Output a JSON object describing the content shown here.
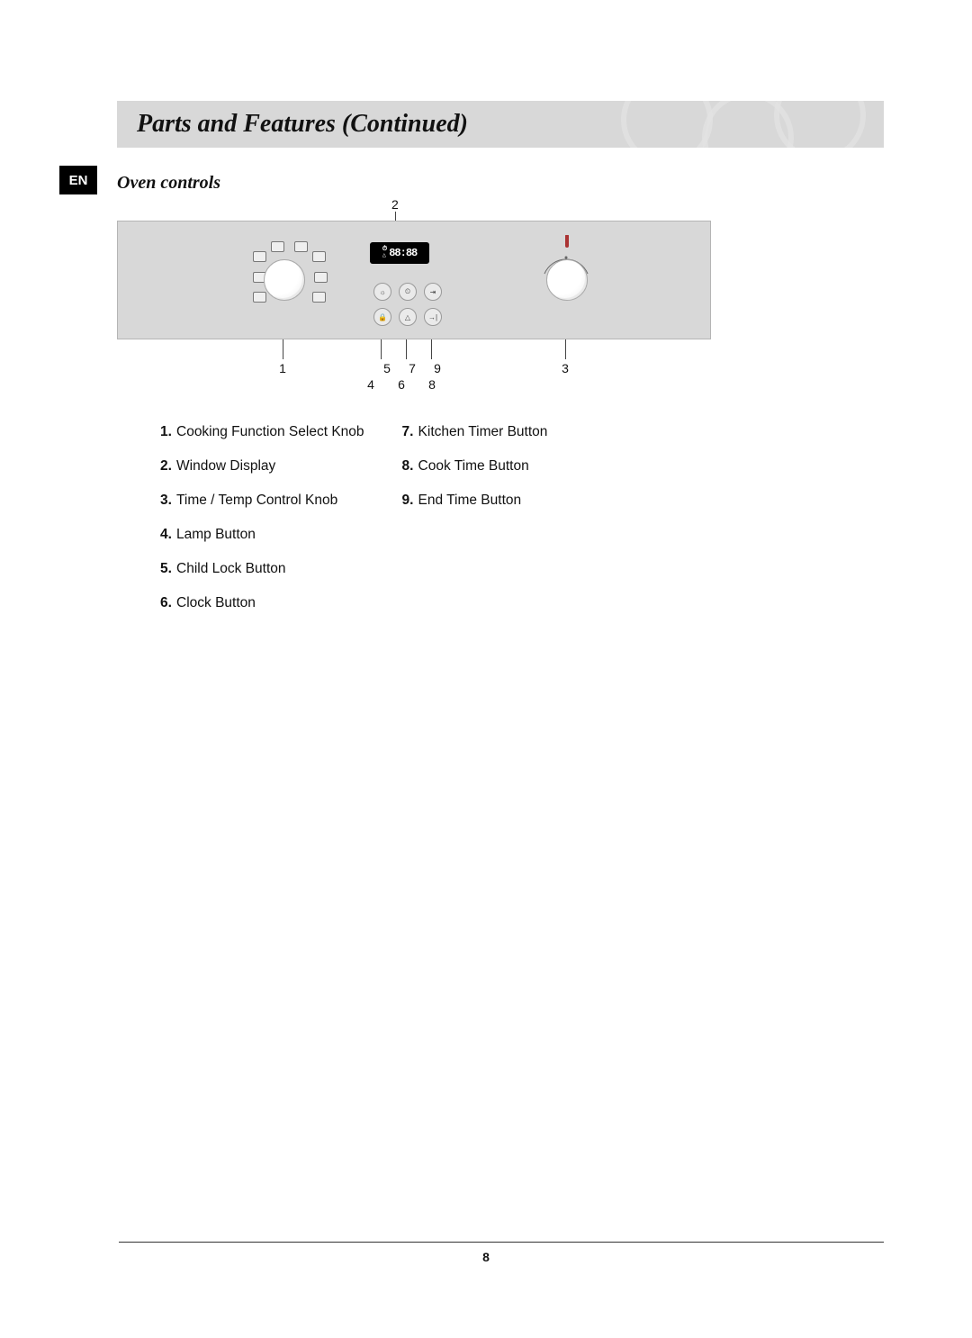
{
  "header": {
    "title": "Parts and Features (Continued)"
  },
  "lang": "EN",
  "subtitle": "Oven controls",
  "diagram": {
    "display_text": "88:88",
    "top_callout": "2",
    "callouts": {
      "c1": "1",
      "c3": "3",
      "c4": "4",
      "c5": "5",
      "c6": "6",
      "c7": "7",
      "c8": "8",
      "c9": "9"
    }
  },
  "legend": {
    "left": [
      {
        "n": "1.",
        "t": "Cooking Function Select Knob"
      },
      {
        "n": "2.",
        "t": "Window Display"
      },
      {
        "n": "3.",
        "t": "Time / Temp Control Knob"
      },
      {
        "n": "4.",
        "t": "Lamp Button"
      },
      {
        "n": "5.",
        "t": "Child Lock Button"
      },
      {
        "n": "6.",
        "t": "Clock Button"
      }
    ],
    "right": [
      {
        "n": "7.",
        "t": "Kitchen Timer Button"
      },
      {
        "n": "8.",
        "t": "Cook Time Button"
      },
      {
        "n": "9.",
        "t": "End Time Button"
      }
    ]
  },
  "page_number": "8"
}
